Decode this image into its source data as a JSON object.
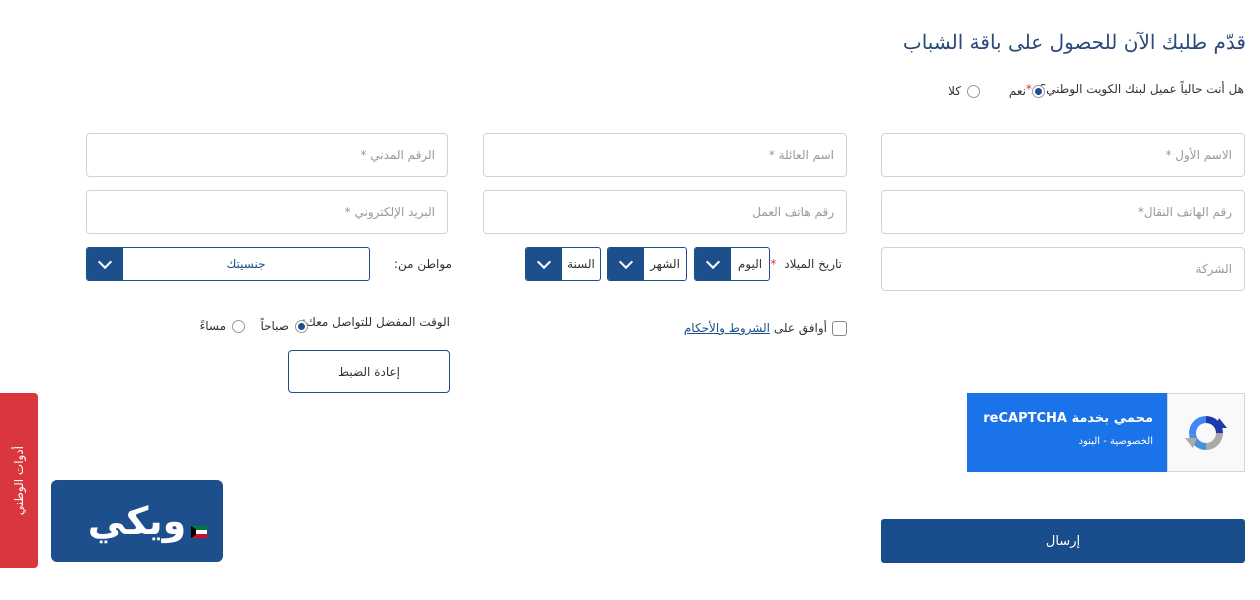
{
  "form": {
    "title": "قدّم طلبك الآن للحصول على باقة الشباب",
    "question": "هل أنت حالياً عميل لبنك الكويت الوطني؟",
    "required_mark": "*",
    "yes_label": "نعم",
    "no_label": "كلا",
    "first_name_ph": "الاسم الأول *",
    "family_name_ph": "اسم العائلة *",
    "civil_id_ph": "الرقم المدني *",
    "mobile_ph": "رقم الهاتف النقال*",
    "work_phone_ph": "رقم هاتف العمل",
    "email_ph": "البريد الإلكتروني *",
    "company_ph": "الشركة",
    "birthdate_label": "تاريخ الميلاد",
    "day_label": "اليوم",
    "month_label": "الشهر",
    "year_label": "السنة",
    "citizen_label": "مواطن من:",
    "nationality_label": "جنسيتك",
    "terms_prefix": "أوافق على",
    "terms_link": "الشروط والأحكام",
    "contact_time_label": "الوقت المفضل للتواصل معك:",
    "morning_label": "صباحاً",
    "evening_label": "مساءً",
    "reset_label": "إعادة الضبط",
    "submit_label": "إرسال"
  },
  "captcha": {
    "line1": "محمي بخدمة reCAPTCHA",
    "line2": "الخصوصية - البنود"
  },
  "side_tab": {
    "label": "أدوات الوطني"
  },
  "brand": {
    "logo_text": "ويكي"
  },
  "colors": {
    "primary": "#1d4f8c",
    "accent_red": "#d9363e",
    "captcha_blue": "#1a73e8"
  }
}
